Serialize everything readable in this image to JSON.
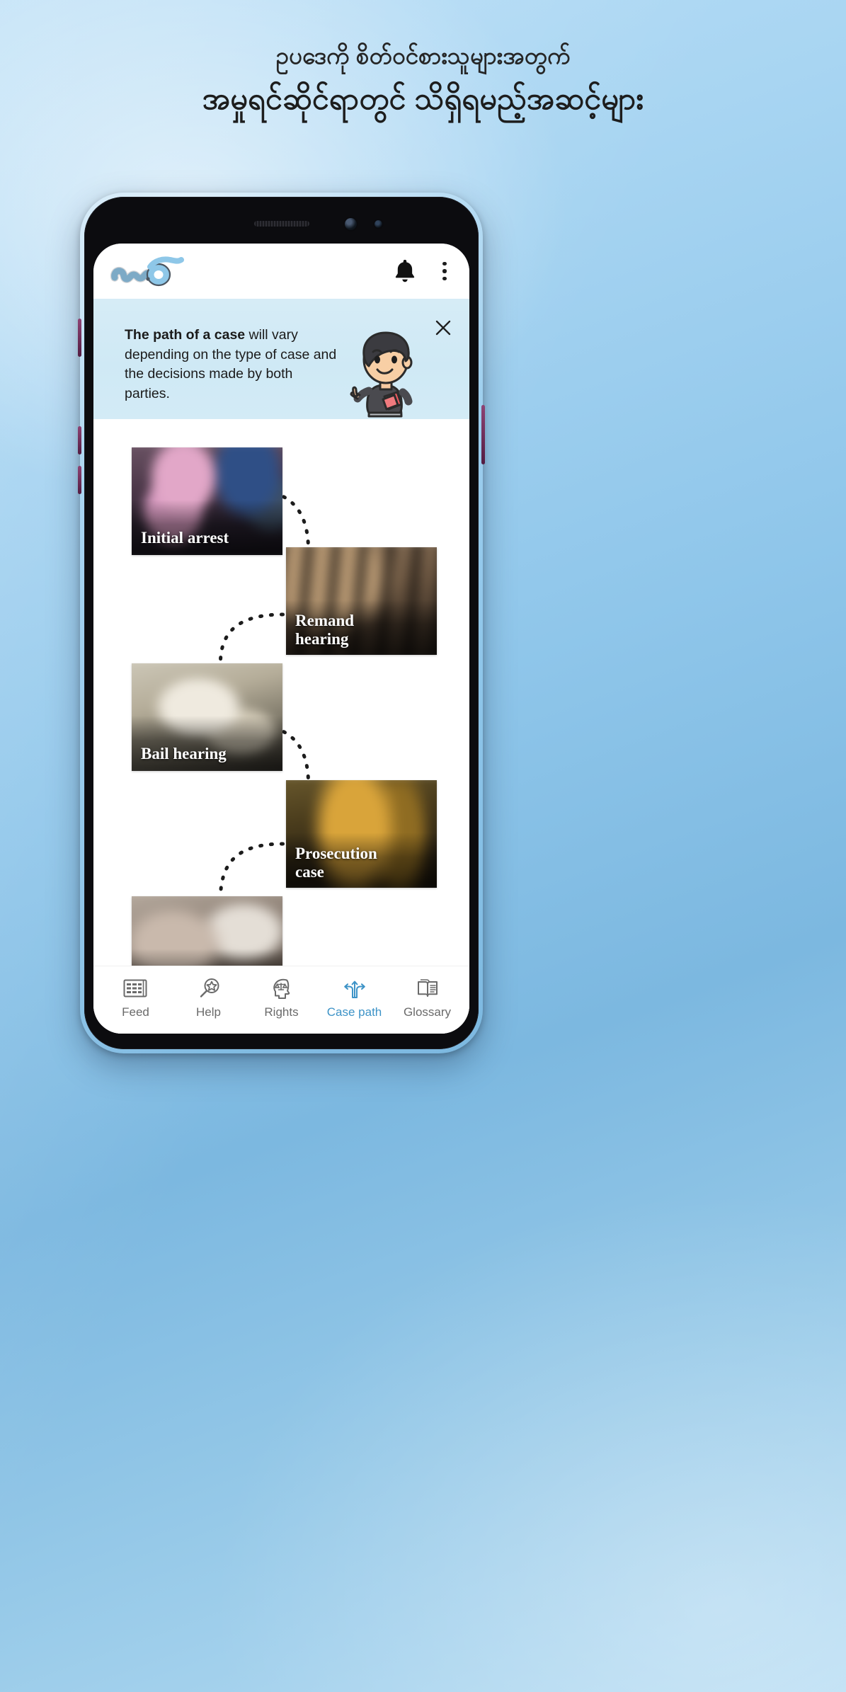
{
  "promo": {
    "line1": "ဥပဒေကို စိတ်ဝင်စားသူများအတွက်",
    "line2": "အမှုရင်ဆိုင်ရာတွင် သိရှိရမည့်အဆင့်များ"
  },
  "app": {
    "logo_alt": "app-logo",
    "notifications_icon": "bell-icon",
    "overflow_icon": "kebab-menu-icon"
  },
  "banner": {
    "bold_text": "The path of a case",
    "rest_text": " will vary depending on the type of case and the decisions made by both parties.",
    "close_icon": "close-icon",
    "mascot_alt": "mascot-character",
    "background_color": "#d3ebf6"
  },
  "flow": {
    "steps": [
      {
        "label": "Initial arrest",
        "side": "left",
        "thumb_class": "t-arrest"
      },
      {
        "label": "Remand\nhearing",
        "side": "right",
        "thumb_class": "t-remand"
      },
      {
        "label": "Bail hearing",
        "side": "left",
        "thumb_class": "t-bail"
      },
      {
        "label": "Prosecution\ncase",
        "side": "right",
        "thumb_class": "t-prosecution"
      },
      {
        "label": "",
        "side": "left",
        "thumb_class": "t-defence"
      }
    ]
  },
  "bottom_nav": {
    "active_color": "#3d93c7",
    "inactive_color": "#6a6a6a",
    "items": [
      {
        "label": "Feed",
        "icon": "feed-grid-icon",
        "active": false
      },
      {
        "label": "Help",
        "icon": "magnifier-star-icon",
        "active": false
      },
      {
        "label": "Rights",
        "icon": "head-scales-icon",
        "active": false
      },
      {
        "label": "Case path",
        "icon": "branching-arrows-icon",
        "active": true
      },
      {
        "label": "Glossary",
        "icon": "open-book-icon",
        "active": false
      }
    ]
  }
}
